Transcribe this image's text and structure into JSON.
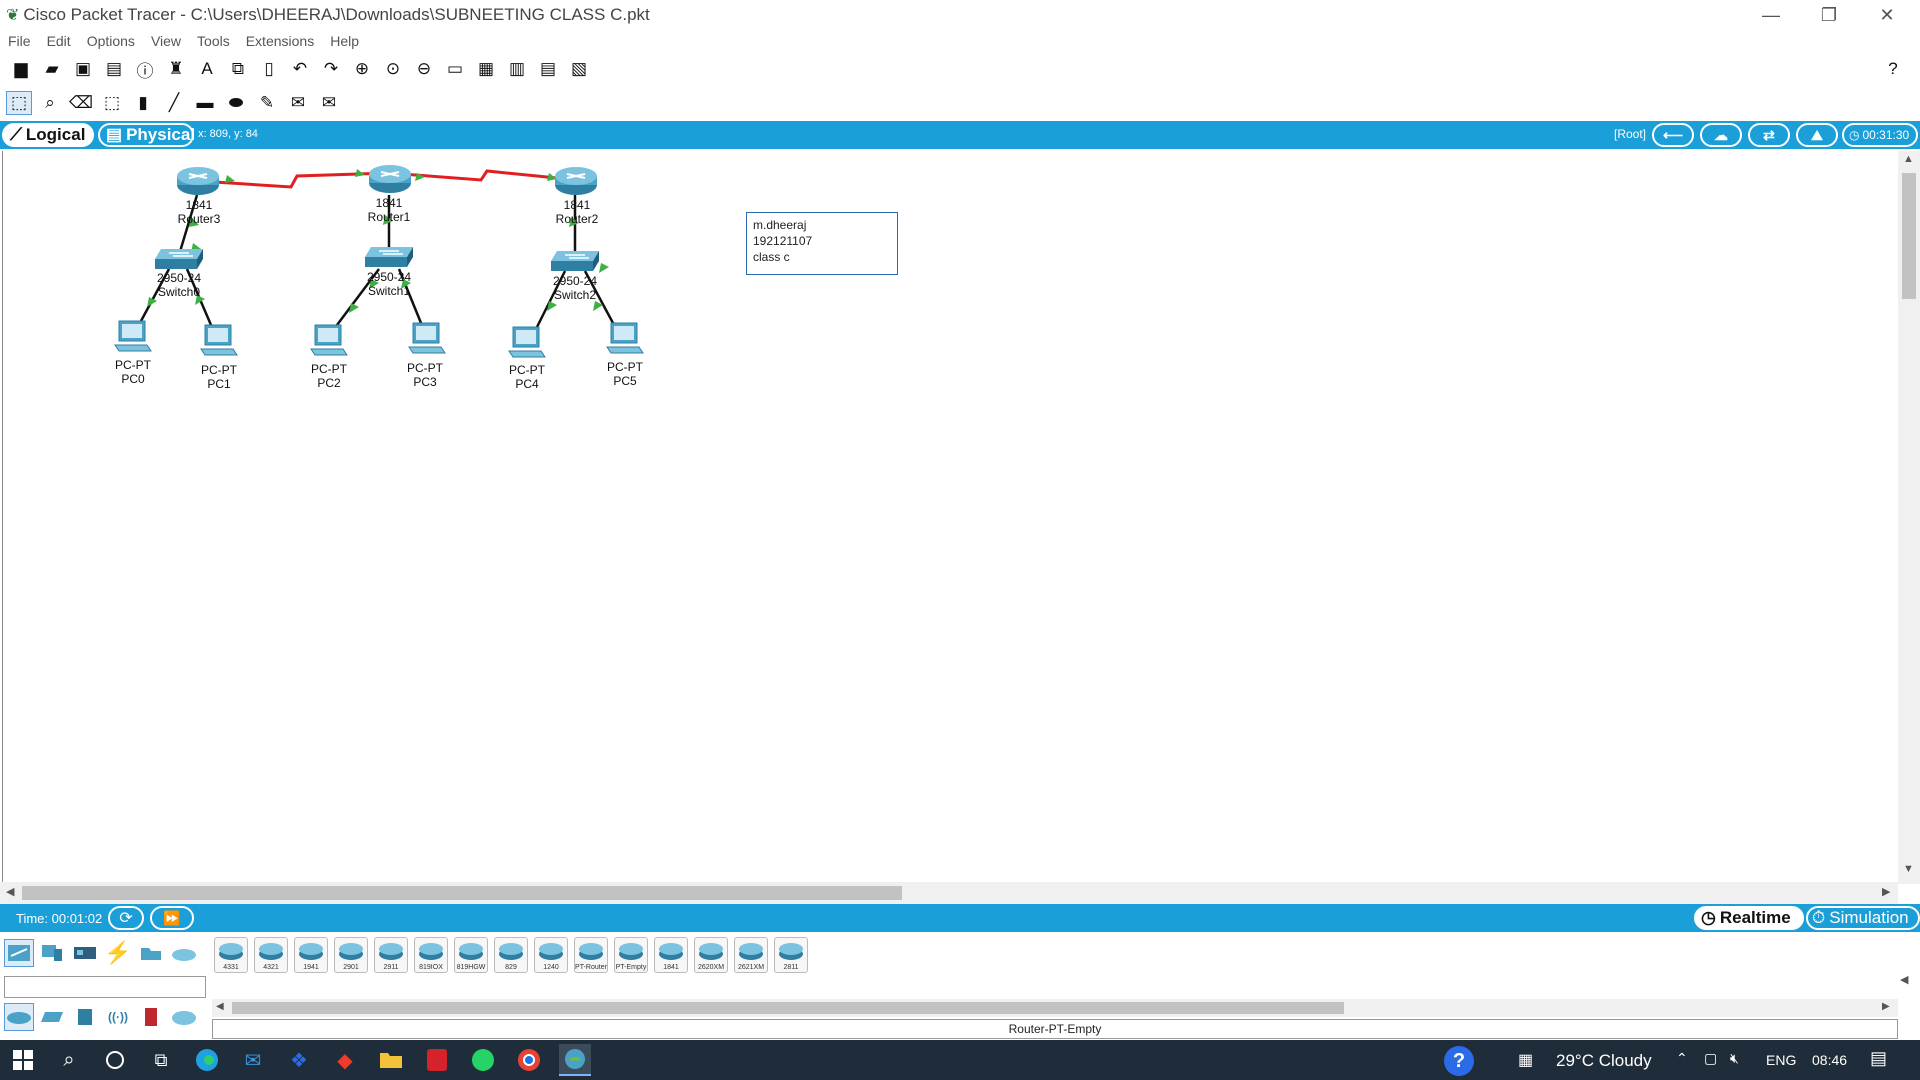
{
  "window": {
    "title": "Cisco Packet Tracer - C:\\Users\\DHEERAJ\\Downloads\\SUBNEETING CLASS C.pkt",
    "help_glyph": "?"
  },
  "menu": [
    "File",
    "Edit",
    "Options",
    "View",
    "Tools",
    "Extensions",
    "Help"
  ],
  "workspace": {
    "logical_label": "Logical",
    "physical_label": "Physical",
    "coords": "x: 809, y: 84",
    "root_label": "[Root]",
    "clock": "00:31:30"
  },
  "devices": {
    "routers": [
      {
        "model": "1841",
        "name": "Router3"
      },
      {
        "model": "1841",
        "name": "Router1"
      },
      {
        "model": "1841",
        "name": "Router2"
      }
    ],
    "switches": [
      {
        "model": "2950-24",
        "name": "Switch0"
      },
      {
        "model": "2950-24",
        "name": "Switch1"
      },
      {
        "model": "2950-24",
        "name": "Switch2"
      }
    ],
    "pcs": [
      {
        "model": "PC-PT",
        "name": "PC0"
      },
      {
        "model": "PC-PT",
        "name": "PC1"
      },
      {
        "model": "PC-PT",
        "name": "PC2"
      },
      {
        "model": "PC-PT",
        "name": "PC3"
      },
      {
        "model": "PC-PT",
        "name": "PC4"
      },
      {
        "model": "PC-PT",
        "name": "PC5"
      }
    ]
  },
  "note": {
    "line1": "m.dheeraj",
    "line2": "192121107",
    "line3": "class c"
  },
  "simbar": {
    "time": "Time: 00:01:02",
    "realtime_label": "Realtime",
    "simulation_label": "Simulation"
  },
  "device_models": [
    "4331",
    "4321",
    "1941",
    "2901",
    "2911",
    "819IOX",
    "819HGW",
    "829",
    "1240",
    "PT-Router",
    "PT-Empty",
    "1841",
    "2620XM",
    "2621XM",
    "2811"
  ],
  "selected_model": "Router-PT-Empty",
  "taskbar": {
    "weather": "29°C  Cloudy",
    "lang": "ENG",
    "time": "08:46"
  },
  "colors": {
    "accent": "#1b9fd9",
    "link_serial": "#e02020",
    "link_ok": "#3cb043",
    "device": "#4aa3c7"
  }
}
